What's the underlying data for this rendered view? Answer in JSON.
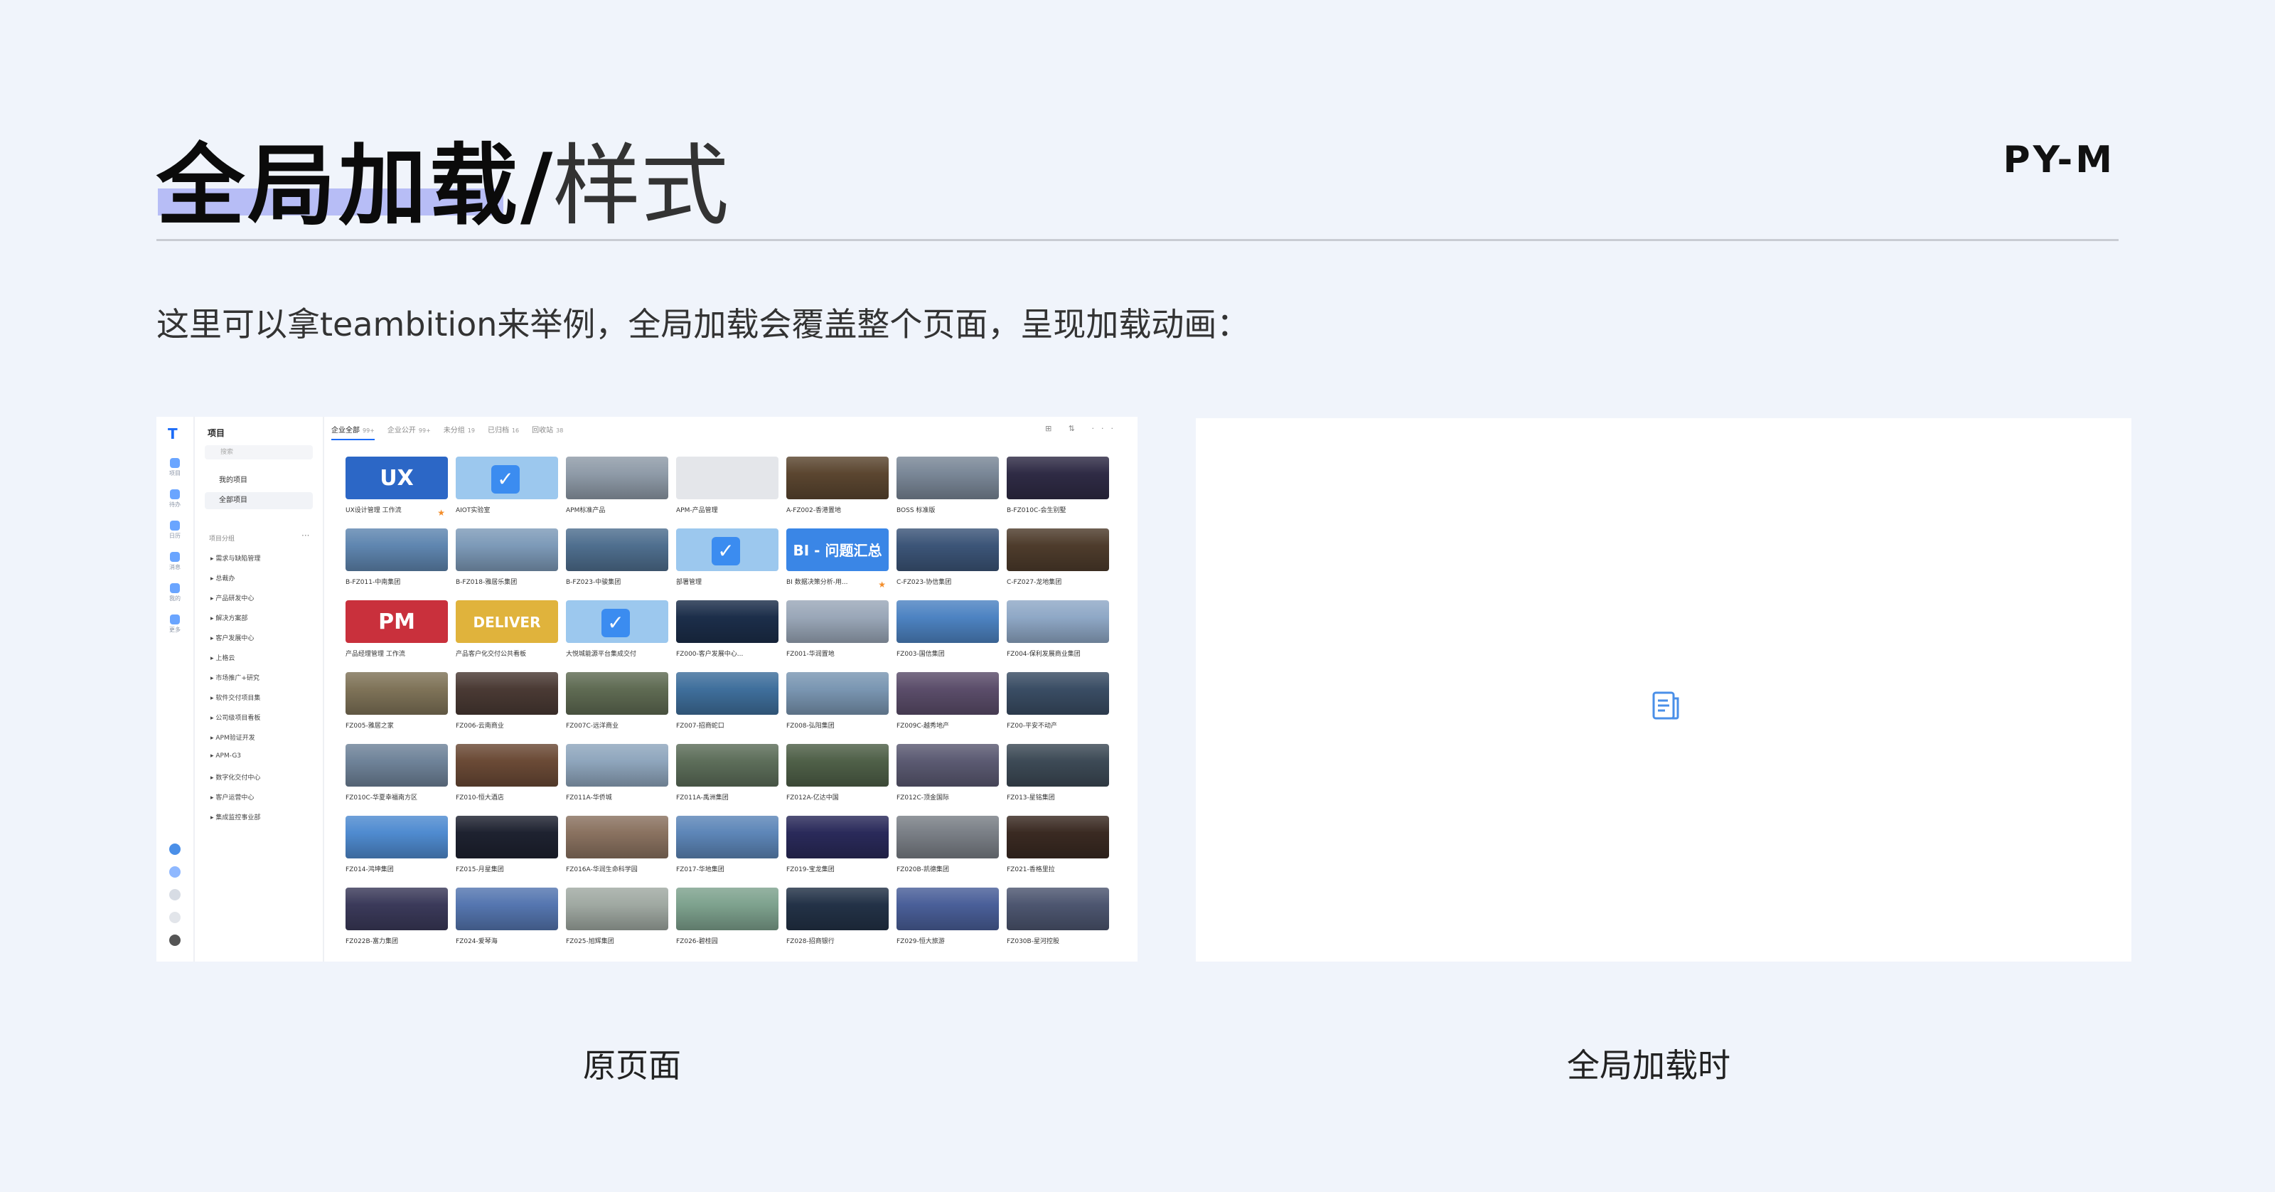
{
  "header": {
    "title_bold": "全局加载",
    "title_slash": "/",
    "title_light": "样式",
    "brand": "PY-M"
  },
  "description": "这里可以拿teambition来举例，全局加载会覆盖整个页面，呈现加载动画：",
  "captions": {
    "left": "原页面",
    "right": "全局加载时"
  },
  "app": {
    "sidebar_title": "项目",
    "search_placeholder": "搜索",
    "nav": [
      {
        "label": "我的项目",
        "active": false
      },
      {
        "label": "全部项目",
        "active": true
      }
    ],
    "group_title": "项目分组",
    "categories": [
      "需求与缺陷管理",
      "总裁办",
      "产品研发中心",
      "解决方案部",
      "客户发展中心",
      "上格云",
      "市场推广+研究",
      "软件交付项目集",
      "公司级项目看板",
      "APM验证开发",
      "APM-G3",
      "数字化交付中心",
      "客户运营中心",
      "集成监控事业部"
    ],
    "rail_items": [
      "项目",
      "待办",
      "日历",
      "消息",
      "我的",
      "更多"
    ],
    "tabs": [
      {
        "label": "企业全部",
        "count": "99+",
        "active": true
      },
      {
        "label": "企业公开",
        "count": "99+",
        "active": false
      },
      {
        "label": "未分组",
        "count": "19",
        "active": false
      },
      {
        "label": "已归档",
        "count": "16",
        "active": false
      },
      {
        "label": "回收站",
        "count": "38",
        "active": false
      }
    ],
    "tools": "⊞ ⇅ ···",
    "projects": [
      {
        "name": "UX设计管理 工作流",
        "thumb": "text",
        "text": "UX",
        "color": "#2c67c6",
        "star": true
      },
      {
        "name": "AIOT实验室",
        "thumb": "check",
        "color": "#9cc8ee"
      },
      {
        "name": "APM标准产品",
        "thumb": "photo",
        "color": "#8f9ba8"
      },
      {
        "name": "APM-产品管理",
        "thumb": "plain",
        "color": "#e4e6ea"
      },
      {
        "name": "A-FZ002-香港置地",
        "thumb": "photo",
        "color": "#5b4630"
      },
      {
        "name": "BOSS 标准版",
        "thumb": "photo",
        "color": "#7a8797"
      },
      {
        "name": "B-FZ010C-会生别墅",
        "thumb": "photo",
        "color": "#2f2b45"
      },
      {
        "name": "B-FZ011-中南集团",
        "thumb": "photo",
        "color": "#5f86b0"
      },
      {
        "name": "B-FZ018-雅居乐集团",
        "thumb": "photo",
        "color": "#7d9ab8"
      },
      {
        "name": "B-FZ023-中骏集团",
        "thumb": "photo",
        "color": "#4f6f8f"
      },
      {
        "name": "部署管理",
        "thumb": "check",
        "color": "#9cc8ee"
      },
      {
        "name": "BI 数据决策分析-用...",
        "thumb": "text",
        "text": "BI - 问题汇总",
        "color": "#3a86e6",
        "star": true
      },
      {
        "name": "C-FZ023-协信集团",
        "thumb": "photo",
        "color": "#3c5578"
      },
      {
        "name": "C-FZ027-龙地集团",
        "thumb": "photo",
        "color": "#4e3c2c"
      },
      {
        "name": "产品经理管理 工作流",
        "thumb": "text",
        "text": "PM",
        "color": "#c9303c"
      },
      {
        "name": "产品客户化交付公共看板",
        "thumb": "text",
        "text": "DELIVER",
        "color": "#e0b33c"
      },
      {
        "name": "大悦城能源平台集成交付",
        "thumb": "check",
        "color": "#9cc8ee"
      },
      {
        "name": "FZ000-客户发展中心...",
        "thumb": "photo",
        "color": "#1c2e4a"
      },
      {
        "name": "FZ001-华润置地",
        "thumb": "photo",
        "color": "#9aa7b8"
      },
      {
        "name": "FZ003-国信集团",
        "thumb": "photo",
        "color": "#4d83c2"
      },
      {
        "name": "FZ004-保利发展商业集团",
        "thumb": "photo",
        "color": "#8fa8c6"
      },
      {
        "name": "FZ005-雅居之家",
        "thumb": "photo",
        "color": "#7f7358"
      },
      {
        "name": "FZ006-云南商业",
        "thumb": "photo",
        "color": "#4a3a34"
      },
      {
        "name": "FZ007C-远洋商业",
        "thumb": "photo",
        "color": "#5f6b53"
      },
      {
        "name": "FZ007-招商蛇口",
        "thumb": "photo",
        "color": "#3f6f9c"
      },
      {
        "name": "FZ008-弘阳集团",
        "thumb": "photo",
        "color": "#7a96b2"
      },
      {
        "name": "FZ009C-越秀地产",
        "thumb": "photo",
        "color": "#5b4d6a"
      },
      {
        "name": "FZ00-平安不动产",
        "thumb": "photo",
        "color": "#3a4d64"
      },
      {
        "name": "FZ010C-华夏幸福南方区",
        "thumb": "photo",
        "color": "#6f8399"
      },
      {
        "name": "FZ010-恒大酒店",
        "thumb": "photo",
        "color": "#6b4a36"
      },
      {
        "name": "FZ011A-华侨城",
        "thumb": "photo",
        "color": "#8fa6bd"
      },
      {
        "name": "FZ011A-禹洲集团",
        "thumb": "photo",
        "color": "#5d6e5a"
      },
      {
        "name": "FZ012A-亿达中国",
        "thumb": "photo",
        "color": "#4f6048"
      },
      {
        "name": "FZ012C-顶金国际",
        "thumb": "photo",
        "color": "#5b5a72"
      },
      {
        "name": "FZ013-星铭集团",
        "thumb": "photo",
        "color": "#3d4a56"
      },
      {
        "name": "FZ014-鸿坤集团",
        "thumb": "photo",
        "color": "#4f8bd0"
      },
      {
        "name": "FZ015-月星集团",
        "thumb": "photo",
        "color": "#1e2230"
      },
      {
        "name": "FZ016A-华润生命科学园",
        "thumb": "photo",
        "color": "#8a7260"
      },
      {
        "name": "FZ017-华地集团",
        "thumb": "photo",
        "color": "#5d86b8"
      },
      {
        "name": "FZ019-宝龙集团",
        "thumb": "photo",
        "color": "#2a2a5a"
      },
      {
        "name": "FZ020B-凯德集团",
        "thumb": "photo",
        "color": "#7a7f86"
      },
      {
        "name": "FZ021-香格里拉",
        "thumb": "photo",
        "color": "#3a2a22"
      },
      {
        "name": "FZ022B-富力集团",
        "thumb": "photo",
        "color": "#3b3a5a"
      },
      {
        "name": "FZ024-爱琴海",
        "thumb": "photo",
        "color": "#5576b0"
      },
      {
        "name": "FZ025-旭辉集团",
        "thumb": "photo",
        "color": "#a0a9a2"
      },
      {
        "name": "FZ026-碧桂园",
        "thumb": "photo",
        "color": "#7ea28e"
      },
      {
        "name": "FZ028-招商银行",
        "thumb": "photo",
        "color": "#233247"
      },
      {
        "name": "FZ029-恒大旅游",
        "thumb": "photo",
        "color": "#4a5f99"
      },
      {
        "name": "FZ030B-星河控股",
        "thumb": "photo",
        "color": "#4d5670"
      }
    ]
  },
  "colors": {
    "accent": "#1c6cf7",
    "title_highlight": "#b7bdf6",
    "loading_icon": "#4a8fe8"
  }
}
